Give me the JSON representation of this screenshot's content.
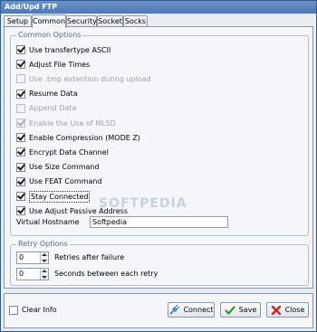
{
  "window": {
    "title": "Add/Upd FTP"
  },
  "tabs": [
    {
      "label": "Setup"
    },
    {
      "label": "Common"
    },
    {
      "label": "Security"
    },
    {
      "label": "Socket"
    },
    {
      "label": "Socks"
    }
  ],
  "active_tab": "Common",
  "common_options": {
    "legend": "Common Options",
    "items": [
      {
        "label": "Use transfertype ASCII",
        "checked": true,
        "enabled": true
      },
      {
        "label": "Adjust File Times",
        "checked": true,
        "enabled": true
      },
      {
        "label": "Use .tmp extention during upload",
        "checked": false,
        "enabled": false
      },
      {
        "label": "Resume Data",
        "checked": true,
        "enabled": true
      },
      {
        "label": "Append Data",
        "checked": false,
        "enabled": false
      },
      {
        "label": "Enable the Use of MLSD",
        "checked": true,
        "enabled": false
      },
      {
        "label": "Enable Compression (MODE Z)",
        "checked": true,
        "enabled": true
      },
      {
        "label": "Encrypt Data Channel",
        "checked": true,
        "enabled": true
      },
      {
        "label": "Use Size Command",
        "checked": true,
        "enabled": true
      },
      {
        "label": "Use FEAT Command",
        "checked": true,
        "enabled": true
      },
      {
        "label": "Stay Connected",
        "checked": true,
        "enabled": true,
        "focused": true
      },
      {
        "label": "Use Adjust Passive Address",
        "checked": true,
        "enabled": true
      }
    ],
    "virtual_hostname_label": "Virtual Hostname",
    "virtual_hostname_value": "Softpedia"
  },
  "retry_options": {
    "legend": "Retry Options",
    "retries_value": "0",
    "retries_label": "Retries after failure",
    "seconds_value": "0",
    "seconds_label": "Seconds between each retry"
  },
  "watermark": "SOFTPEDIA",
  "footer": {
    "clear_info_label": "Clear Info",
    "clear_info_checked": false,
    "connect_label": "Connect",
    "save_label": "Save",
    "close_label": "Close"
  },
  "colors": {
    "title_bar": "#4e77b3",
    "panel_bg": "#f4f6fa",
    "save_icon": "#2f9a2f",
    "close_icon": "#d02020"
  }
}
